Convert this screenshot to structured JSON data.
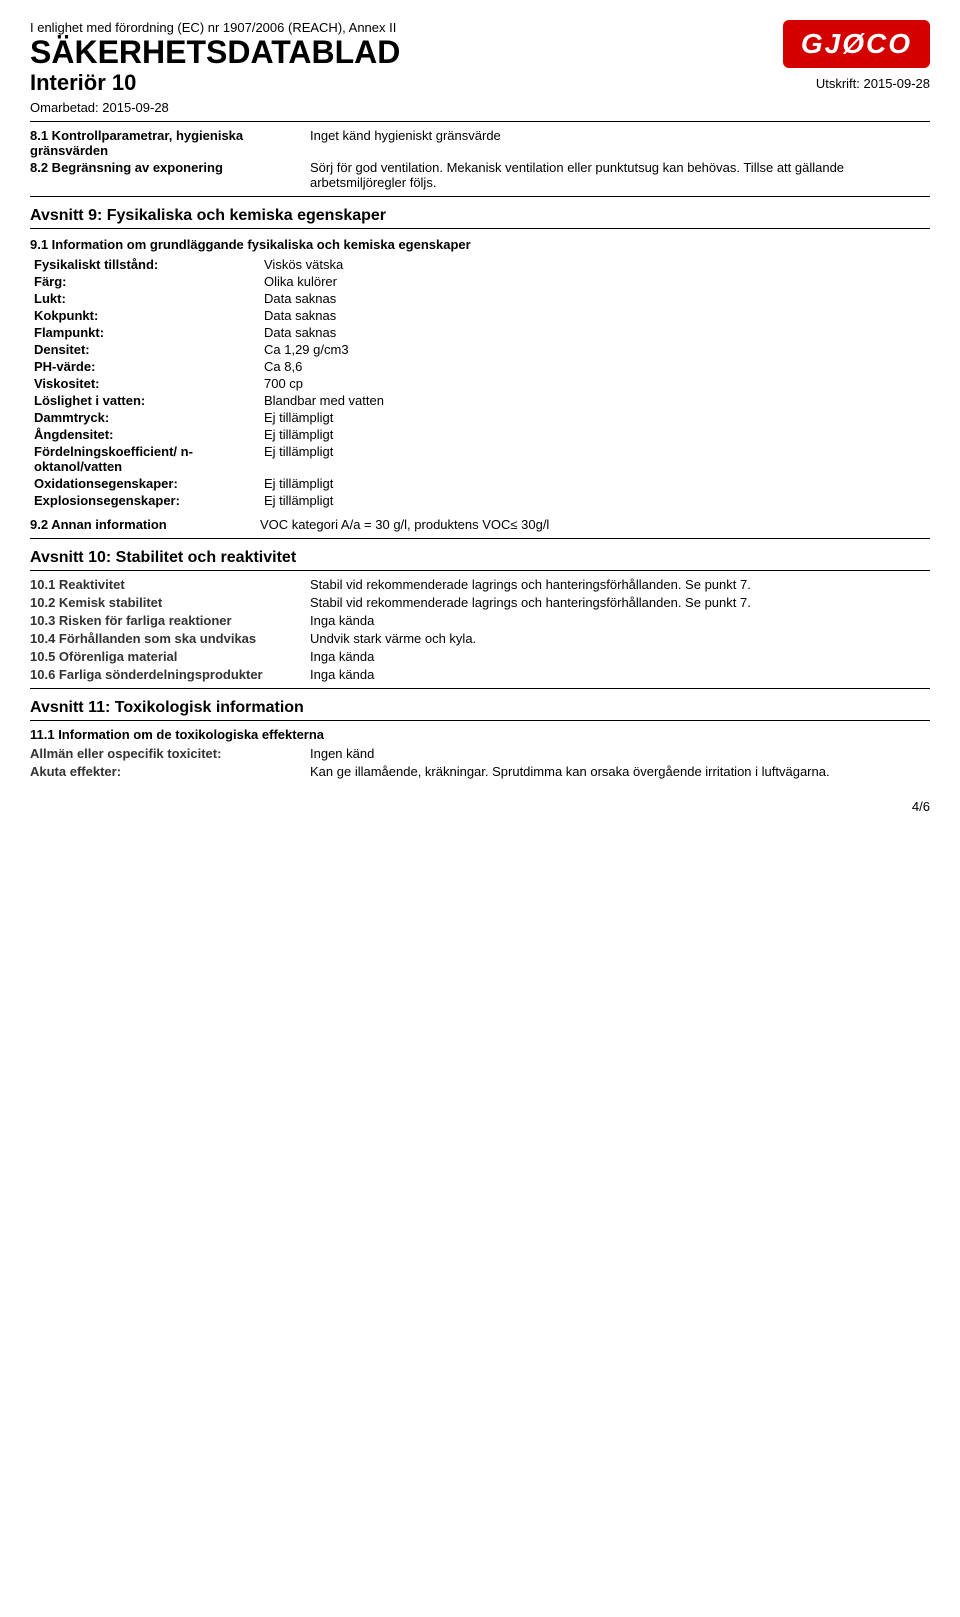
{
  "regulation": "I enlighet med förordning (EC) nr 1907/2006 (REACH), Annex II",
  "main_title": "SÄKERHETSDATABLAD",
  "product_title": "Interiör 10",
  "omarbetad_label": "Omarbetad:",
  "omarbetad_date": "2015-09-28",
  "utskrift_label": "Utskrift:",
  "utskrift_date": "2015-09-28",
  "logo_text": "GJØCO",
  "section8": {
    "item1_label": "8.1 Kontrollparametrar, hygieniska gränsvärden",
    "item1_value": "Inget känd hygieniskt gränsvärde",
    "item2_label": "8.2 Begränsning av exponering",
    "item2_value": "Sörj för god ventilation. Mekanisk ventilation eller punktutsug kan behövas. Tillse att gällande arbetsmiljöregler följs."
  },
  "section9": {
    "heading": "Avsnitt 9: Fysikaliska och kemiska egenskaper",
    "sub_heading": "9.1 Information om grundläggande fysikaliska och kemiska egenskaper",
    "properties": [
      {
        "label": "Fysikaliskt tillstånd:",
        "value": "Viskös vätska"
      },
      {
        "label": "Färg:",
        "value": "Olika kulörer"
      },
      {
        "label": "Lukt:",
        "value": "Data saknas"
      },
      {
        "label": "Kokpunkt:",
        "value": "Data saknas"
      },
      {
        "label": "Flampunkt:",
        "value": "Data saknas"
      },
      {
        "label": "Densitet:",
        "value": "Ca 1,29 g/cm3"
      },
      {
        "label": "PH-värde:",
        "value": "Ca 8,6"
      },
      {
        "label": "Viskositet:",
        "value": "700 cp"
      },
      {
        "label": "Löslighet i vatten:",
        "value": "Blandbar med vatten"
      },
      {
        "label": "Dammtryck:",
        "value": "Ej tillämpligt"
      },
      {
        "label": "Ångdensitet:",
        "value": "Ej tillämpligt"
      },
      {
        "label": "Fördelningskoefficient/ n-oktanol/vatten",
        "value": "Ej tillämpligt"
      },
      {
        "label": "Oxidationsegenskaper:",
        "value": "Ej tillämpligt"
      },
      {
        "label": "Explosionsegenskaper:",
        "value": "Ej tillämpligt"
      }
    ],
    "annan_label": "9.2 Annan information",
    "annan_value": "VOC kategori A/a = 30 g/l, produktens VOC≤ 30g/l"
  },
  "section10": {
    "heading": "Avsnitt 10: Stabilitet och reaktivitet",
    "items": [
      {
        "label": "10.1 Reaktivitet",
        "value": "Stabil vid rekommenderade lagrings och hanteringsförhållanden. Se punkt 7."
      },
      {
        "label": "10.2 Kemisk stabilitet",
        "value": "Stabil vid rekommenderade lagrings och hanteringsförhållanden. Se punkt 7."
      },
      {
        "label": "10.3 Risken för farliga reaktioner",
        "value": "Inga kända"
      },
      {
        "label": "10.4 Förhållanden som ska undvikas",
        "value": "Undvik stark värme och kyla."
      },
      {
        "label": "10.5 Oförenliga material",
        "value": "Inga kända"
      },
      {
        "label": "10.6 Farliga sönderdelningsprodukter",
        "value": "Inga kända"
      }
    ]
  },
  "section11": {
    "heading": "Avsnitt 11: Toxikologisk information",
    "sub_heading": "11.1 Information om de toxikologiska effekterna",
    "items": [
      {
        "label": "Allmän eller ospecifik toxicitet:",
        "value": "Ingen känd"
      },
      {
        "label": "Akuta effekter:",
        "value": "Kan ge illamående, kräkningar. Sprutdimma kan orsaka övergående irritation i luftvägarna."
      }
    ]
  },
  "page_number": "4/6"
}
